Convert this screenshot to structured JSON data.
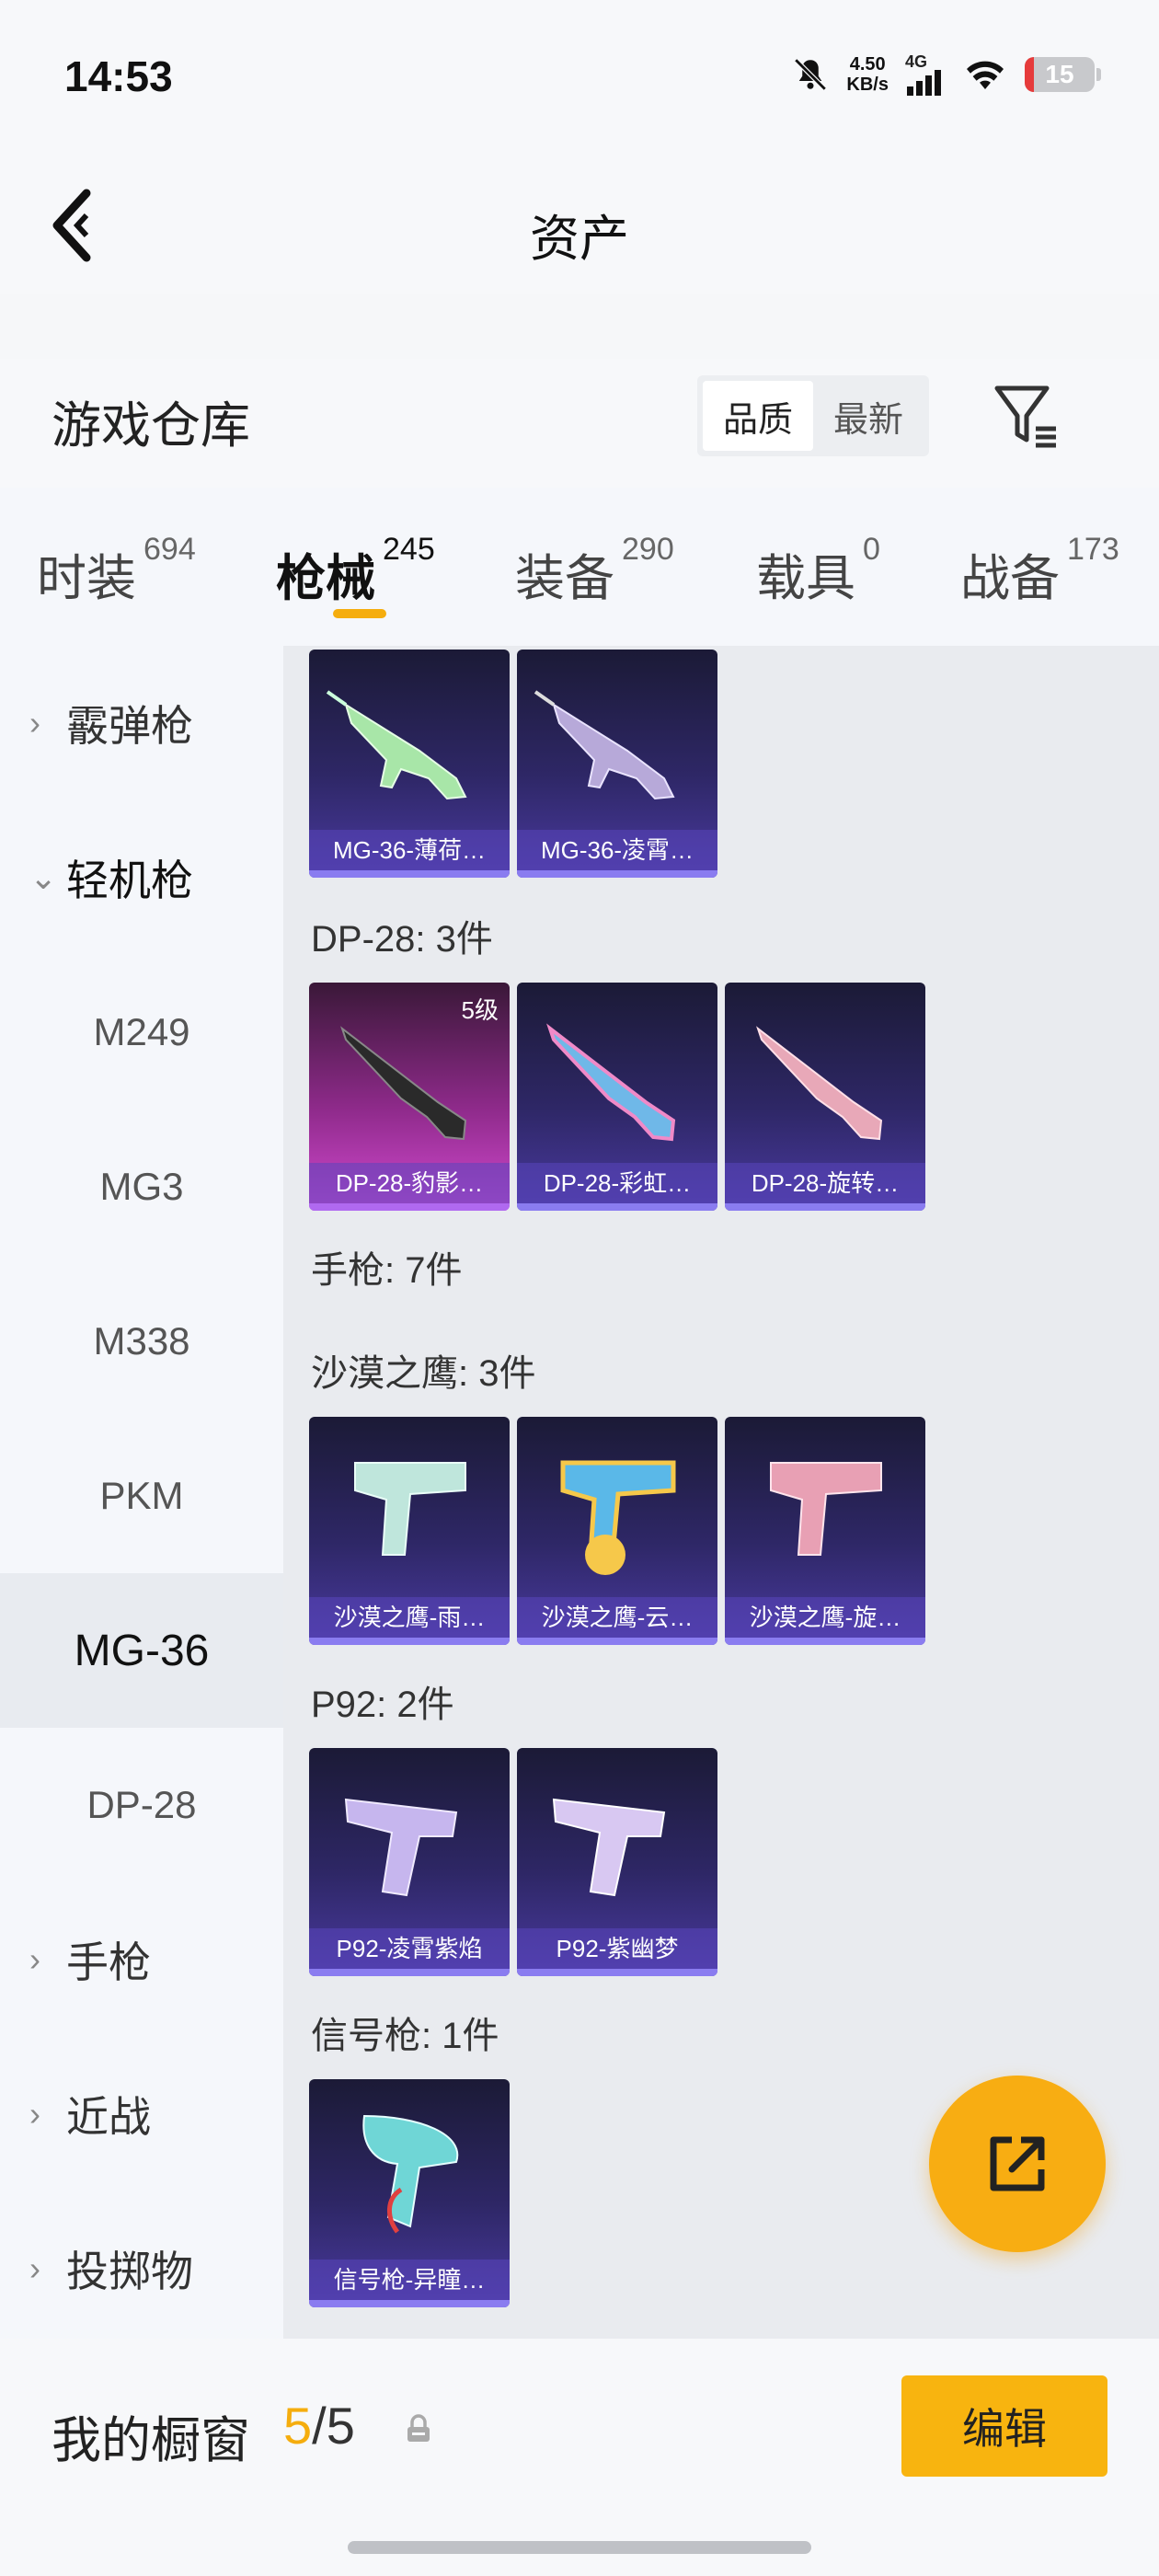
{
  "status_bar": {
    "time": "14:53",
    "net_speed_value": "4.50",
    "net_speed_unit": "KB/s",
    "network": "4G",
    "battery": "15",
    "icons": [
      "bell-off-icon",
      "signal-icon",
      "wifi-icon",
      "battery-icon"
    ]
  },
  "header": {
    "title": "资产",
    "back_icon": "chevron-left-icon"
  },
  "repo": {
    "title": "游戏仓库",
    "sort_options": [
      "品质",
      "最新"
    ],
    "sort_selected": "品质",
    "filter_icon": "filter-icon"
  },
  "tabs": [
    {
      "label": "时装",
      "count": "694"
    },
    {
      "label": "枪械",
      "count": "245",
      "active": true
    },
    {
      "label": "装备",
      "count": "290"
    },
    {
      "label": "载具",
      "count": "0"
    },
    {
      "label": "战备",
      "count": "173"
    }
  ],
  "sidenav": [
    {
      "label": "霰弹枪",
      "type": "group",
      "expanded": false
    },
    {
      "label": "轻机枪",
      "type": "group",
      "expanded": true
    },
    {
      "label": "M249",
      "type": "sub"
    },
    {
      "label": "MG3",
      "type": "sub"
    },
    {
      "label": "M338",
      "type": "sub"
    },
    {
      "label": "PKM",
      "type": "sub"
    },
    {
      "label": "MG-36",
      "type": "sub",
      "selected": true
    },
    {
      "label": "DP-28",
      "type": "sub"
    },
    {
      "label": "手枪",
      "type": "group",
      "expanded": false
    },
    {
      "label": "近战",
      "type": "group",
      "expanded": false
    },
    {
      "label": "投掷物",
      "type": "group",
      "expanded": false
    }
  ],
  "content": {
    "mg36_items": [
      "MG-36-薄荷…",
      "MG-36-凌霄…"
    ],
    "dp28_header": "DP-28: 3件",
    "dp28_items": [
      {
        "name": "DP-28-豹影…",
        "level": "5级"
      },
      {
        "name": "DP-28-彩虹…"
      },
      {
        "name": "DP-28-旋转…"
      }
    ],
    "pistol_header": "手枪: 7件",
    "deagle_header": "沙漠之鹰: 3件",
    "deagle_items": [
      "沙漠之鹰-雨…",
      "沙漠之鹰-云…",
      "沙漠之鹰-旋…"
    ],
    "p92_header": "P92: 2件",
    "p92_items": [
      "P92-凌霄紫焰",
      "P92-紫幽梦"
    ],
    "flare_header": "信号枪: 1件",
    "flare_items": [
      "信号枪-异瞳…"
    ]
  },
  "fab": {
    "icon": "share-external-icon"
  },
  "bottom": {
    "showcase_label": "我的橱窗",
    "showcase_current": "5",
    "showcase_sep_total": "/5",
    "lock_icon": "lock-icon",
    "edit_label": "编辑"
  },
  "colors": {
    "accent": "#f5ad0e",
    "edit_button": "#f8b40f",
    "card_dark": "#2e2766",
    "card_pink": "#d24ad0"
  }
}
